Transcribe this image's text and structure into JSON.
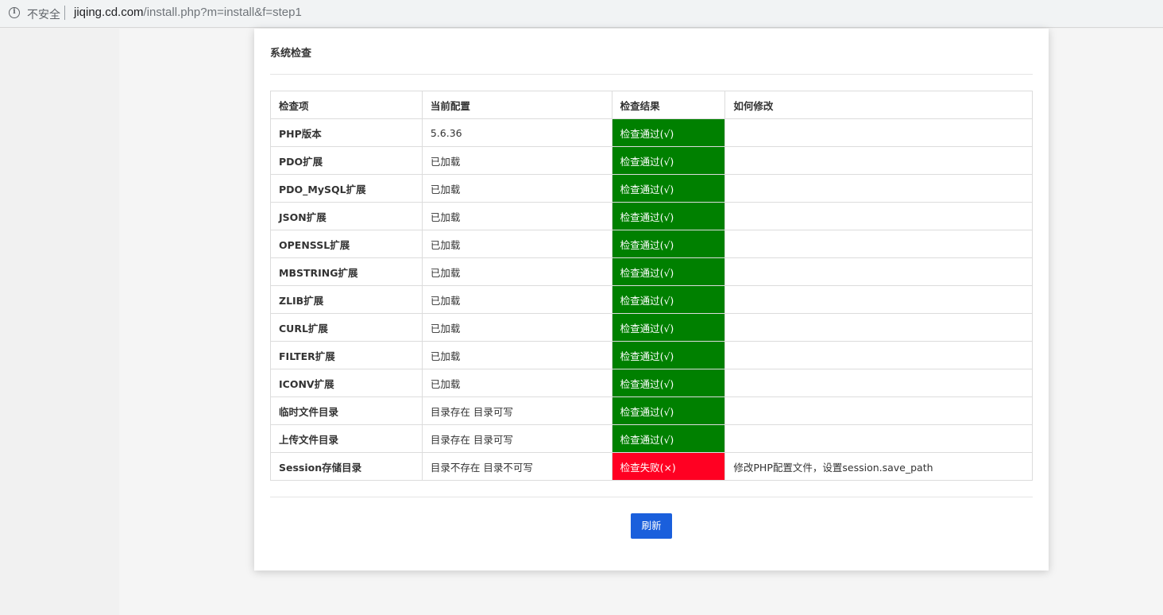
{
  "browser": {
    "security_label": "不安全",
    "url_host": "jiqing.cd.com",
    "url_path": "/install.php?m=install&f=step1"
  },
  "page": {
    "title": "系统检查",
    "refresh_label": "刷新"
  },
  "table": {
    "headers": [
      "检查项",
      "当前配置",
      "检查结果",
      "如何修改"
    ],
    "rows": [
      {
        "item": "PHP版本",
        "config": "5.6.36",
        "result": "检查通过(√)",
        "status": "pass",
        "fix": ""
      },
      {
        "item": "PDO扩展",
        "config": "已加载",
        "result": "检查通过(√)",
        "status": "pass",
        "fix": ""
      },
      {
        "item": "PDO_MySQL扩展",
        "config": "已加载",
        "result": "检查通过(√)",
        "status": "pass",
        "fix": ""
      },
      {
        "item": "JSON扩展",
        "config": "已加载",
        "result": "检查通过(√)",
        "status": "pass",
        "fix": ""
      },
      {
        "item": "OPENSSL扩展",
        "config": "已加载",
        "result": "检查通过(√)",
        "status": "pass",
        "fix": ""
      },
      {
        "item": "MBSTRING扩展",
        "config": "已加载",
        "result": "检查通过(√)",
        "status": "pass",
        "fix": ""
      },
      {
        "item": "ZLIB扩展",
        "config": "已加载",
        "result": "检查通过(√)",
        "status": "pass",
        "fix": ""
      },
      {
        "item": "CURL扩展",
        "config": "已加载",
        "result": "检查通过(√)",
        "status": "pass",
        "fix": ""
      },
      {
        "item": "FILTER扩展",
        "config": "已加载",
        "result": "检查通过(√)",
        "status": "pass",
        "fix": ""
      },
      {
        "item": "ICONV扩展",
        "config": "已加载",
        "result": "检查通过(√)",
        "status": "pass",
        "fix": ""
      },
      {
        "item": "临时文件目录",
        "config": "目录存在 目录可写",
        "result": "检查通过(√)",
        "status": "pass",
        "fix": ""
      },
      {
        "item": "上传文件目录",
        "config": "目录存在 目录可写",
        "result": "检查通过(√)",
        "status": "pass",
        "fix": ""
      },
      {
        "item": "Session存储目录",
        "config": "目录不存在 目录不可写",
        "result": "检查失败(×)",
        "status": "fail",
        "fix": "修改PHP配置文件，设置session.save_path"
      }
    ]
  },
  "colors": {
    "pass": "#008000",
    "fail": "#ff0022",
    "button": "#1a5fdc"
  },
  "icons": {
    "security": "info-icon"
  }
}
